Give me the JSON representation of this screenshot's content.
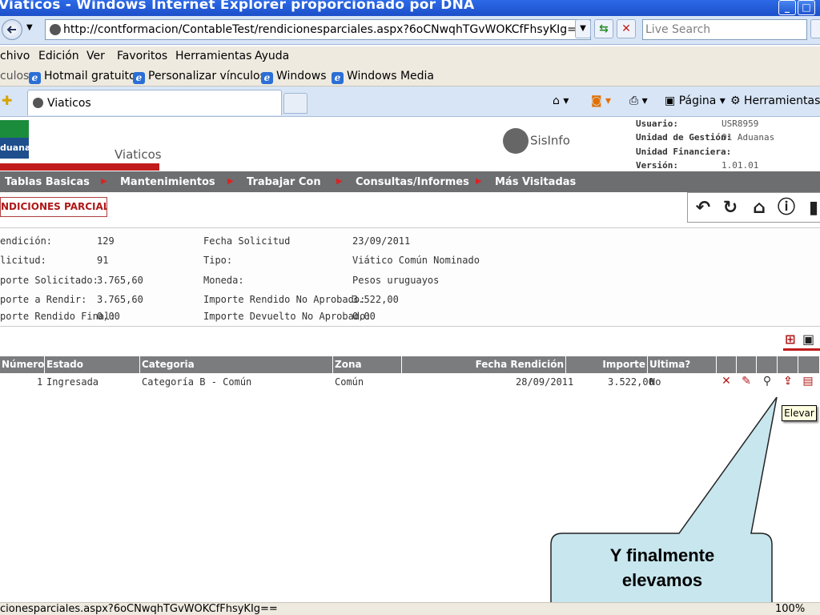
{
  "browser": {
    "title": "Viaticos - Windows Internet Explorer proporcionado por DNA",
    "url": "http://contformacion/ContableTest/rendicionesparciales.aspx?6oCNwqhTGvWOKCfFhsyKIg==",
    "search_placeholder": "Live Search",
    "menu": [
      "chivo",
      "Edición",
      "Ver",
      "Favoritos",
      "Herramientas",
      "Ayuda"
    ],
    "links_label": "culos",
    "links": [
      "Hotmail gratuito",
      "Personalizar vínculos",
      "Windows",
      "Windows Media"
    ],
    "tab_title": "Viaticos",
    "tools": {
      "page": "Página",
      "tools": "Herramientas"
    },
    "status_url": "cionesparciales.aspx?6oCNwqhTGvWOKCfFhsyKIg==",
    "zoom": "100%"
  },
  "app": {
    "logo_text": "duanas",
    "title": "Viaticos",
    "brand": "SisInfo",
    "user_info": {
      "usuario_label": "Usuario:",
      "usuario": "USR8959",
      "unidad_gestion_label": "Unidad de Gestión:",
      "unidad_gestion": "01 Aduanas",
      "unidad_financiera_label": "Unidad Financiera:",
      "unidad_financiera": "",
      "version_label": "Versión:",
      "version": "1.01.01"
    },
    "nav": [
      "Tablas Basicas",
      "Mantenimientos",
      "Trabajar Con",
      "Consultas/Informes",
      "Más Visitadas"
    ],
    "section_title": "NDICIONES PARCIALES",
    "details": {
      "rendicion_label": "endición:",
      "rendicion": "129",
      "solicitud_label": "licitud:",
      "solicitud": "91",
      "importe_solicitado_label": "porte Solicitado:",
      "importe_solicitado": "3.765,60",
      "importe_rendir_label": "porte a Rendir:",
      "importe_rendir": "3.765,60",
      "importe_rendido_final_label": "porte Rendido Final:",
      "importe_rendido_final": "0,00",
      "fecha_solicitud_label": "Fecha Solicitud",
      "fecha_solicitud": "23/09/2011",
      "tipo_label": "Tipo:",
      "tipo": "Viático Común Nominado",
      "moneda_label": "Moneda:",
      "moneda": "Pesos uruguayos",
      "importe_rendido_no_aprobado_label": "Importe Rendido No Aprobado:",
      "importe_rendido_no_aprobado": "3.522,00",
      "importe_devuelto_no_aprobado_label": "Importe Devuelto No Aprobado:",
      "importe_devuelto_no_aprobado": "0,00"
    },
    "grid": {
      "columns": [
        "Número",
        "Estado",
        "Categoria",
        "Zona",
        "Fecha Rendición",
        "Importe",
        "Ultima?"
      ],
      "row": {
        "numero": "1",
        "estado": "Ingresada",
        "categoria": "Categoría B - Común",
        "zona": "Común",
        "fecha": "28/09/2011",
        "importe": "3.522,00",
        "ultima": "No"
      }
    },
    "tooltip": "Elevar"
  },
  "callout": {
    "line1": "Y finalmente",
    "line2": "elevamos",
    "fill": "#c7e6ee"
  }
}
